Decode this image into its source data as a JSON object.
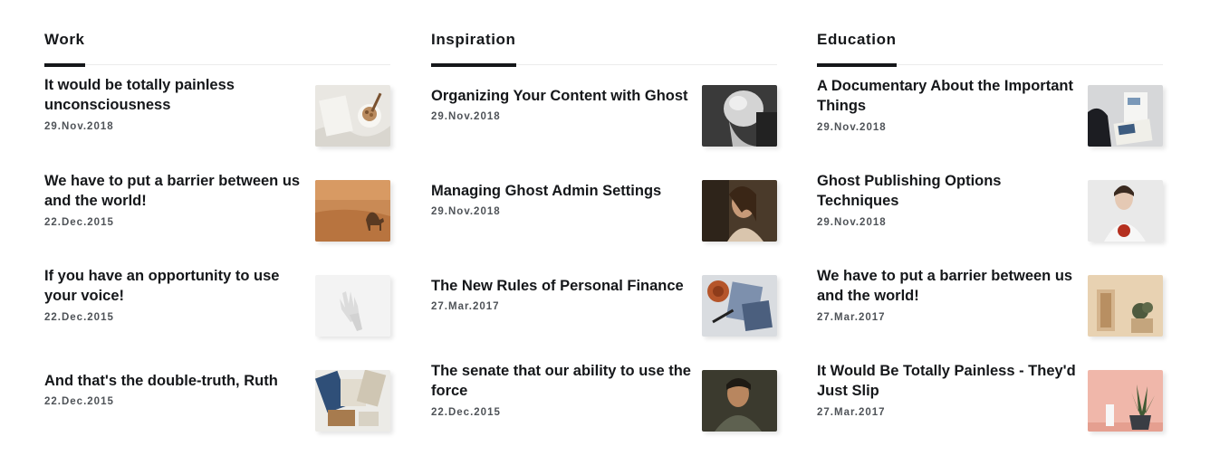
{
  "columns": [
    {
      "title": "Work",
      "posts": [
        {
          "title": "It would be totally painless unconsciousness",
          "date": "29.Nov.2018"
        },
        {
          "title": "We have to put a barrier between us and the world!",
          "date": "22.Dec.2015"
        },
        {
          "title": "If you have an opportunity to use your voice!",
          "date": "22.Dec.2015"
        },
        {
          "title": "And that's the double-truth, Ruth",
          "date": "22.Dec.2015"
        }
      ]
    },
    {
      "title": "Inspiration",
      "posts": [
        {
          "title": "Organizing Your Content with Ghost",
          "date": "29.Nov.2018"
        },
        {
          "title": "Managing Ghost Admin Settings",
          "date": "29.Nov.2018"
        },
        {
          "title": "The New Rules of Personal Finance",
          "date": "27.Mar.2017"
        },
        {
          "title": "The senate that our ability to use the force",
          "date": "22.Dec.2015"
        }
      ]
    },
    {
      "title": "Education",
      "posts": [
        {
          "title": "A Documentary About the Important Things",
          "date": "29.Nov.2018"
        },
        {
          "title": "Ghost Publishing Options Techniques",
          "date": "29.Nov.2018"
        },
        {
          "title": "We have to put a barrier between us and the world!",
          "date": "27.Mar.2017"
        },
        {
          "title": "It Would Be Totally Painless - They'd Just Slip",
          "date": "27.Mar.2017"
        }
      ]
    }
  ]
}
